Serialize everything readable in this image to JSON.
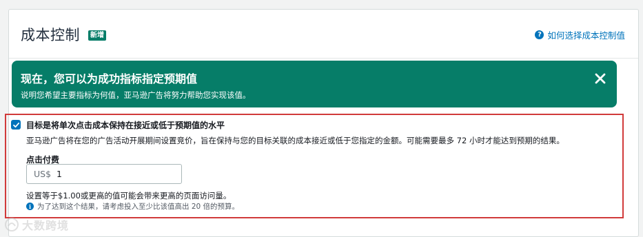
{
  "header": {
    "title": "成本控制",
    "badge": "新增",
    "help_link": "如何选择成本控制值",
    "help_icon": "help-circle-icon"
  },
  "banner": {
    "title": "现在，您可以为成功指标指定预期值",
    "description": "说明您希望主要指标为何值，亚马逊广告将努力帮助您实现该值。",
    "close_icon": "close-icon",
    "background_color": "#067d68"
  },
  "cost_control": {
    "checked": true,
    "checkbox_label": "目标是将单次点击成本保持在接近或低于预期值的水平",
    "description": "亚马逊广告将在您的广告活动开展期间设置竞价，旨在保持与您的目标关联的成本接近或低于您指定的金额。可能需要最多 72 小时才能达到预期的结果。",
    "field_label": "点击付费",
    "currency": "US$",
    "value": "1",
    "hint": "设置等于$1.00或更高的值可能会带来更高的页面访问量。",
    "info_text": "为了达到这个结果，请考虑投入至少比该值高出 20 倍的预算。",
    "info_icon": "info-icon"
  },
  "watermark": {
    "text": "大数跨境"
  },
  "colors": {
    "accent": "#067d68",
    "link": "#0073bb",
    "highlight_border": "#d13a3a"
  }
}
